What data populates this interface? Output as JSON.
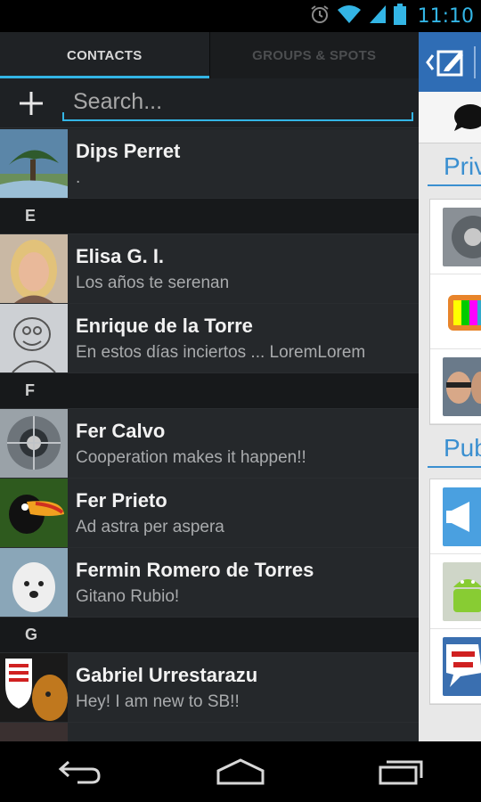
{
  "status_bar": {
    "time": "11:10",
    "icons": [
      "alarm-icon",
      "wifi-icon",
      "signal-icon",
      "battery-icon"
    ]
  },
  "tabs": [
    {
      "label": "CONTACTS",
      "active": true
    },
    {
      "label": "GROUPS & SPOTS",
      "active": false
    }
  ],
  "search": {
    "placeholder": "Search..."
  },
  "contacts": {
    "first": {
      "name": "Dips Perret",
      "status": "."
    },
    "sections": [
      {
        "letter": "E",
        "items": [
          {
            "name": "Elisa G. I.",
            "status": "Los años te serenan"
          },
          {
            "name": "Enrique de la Torre",
            "status": "En estos días inciertos ... LoremLorem"
          }
        ]
      },
      {
        "letter": "F",
        "items": [
          {
            "name": "Fer Calvo",
            "status": "Cooperation makes it happen!!"
          },
          {
            "name": "Fer Prieto",
            "status": "Ad astra per aspera"
          },
          {
            "name": "Fermin Romero de Torres",
            "status": "Gitano Rubio!"
          }
        ]
      },
      {
        "letter": "G",
        "items": [
          {
            "name": "Gabriel Urrestarazu",
            "status": "Hey! I am new to SB!!"
          }
        ]
      }
    ]
  },
  "right_panel": {
    "private_header": "Priva",
    "public_header": "Publ"
  },
  "colors": {
    "accent": "#33b5e5",
    "panel_blue": "#2f6db5"
  }
}
